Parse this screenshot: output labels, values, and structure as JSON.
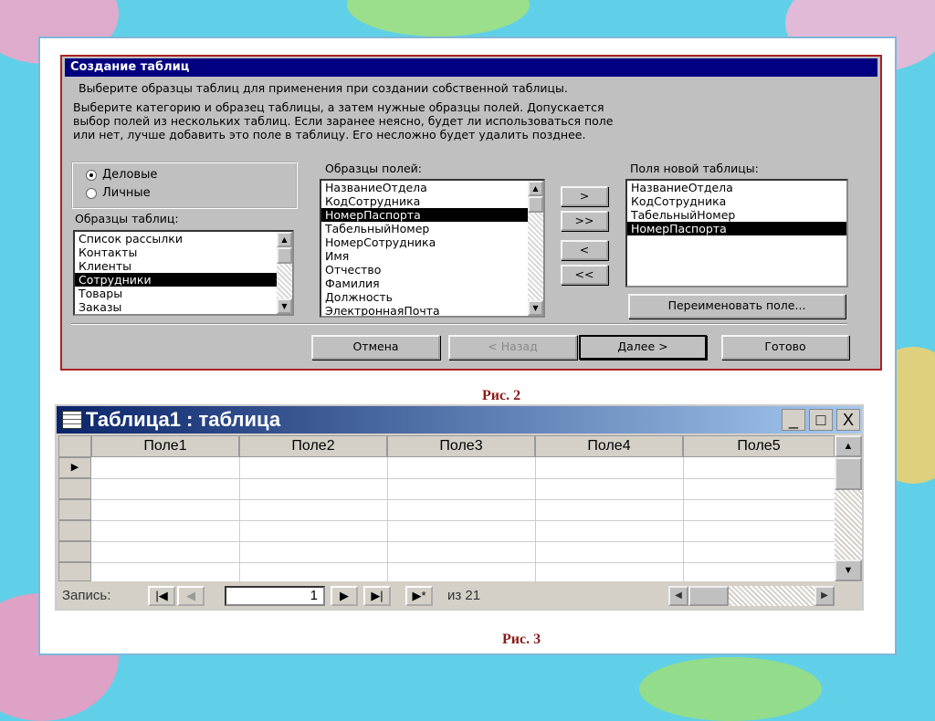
{
  "dialog": {
    "title": "Создание таблиц",
    "subtitle": "Выберите образцы таблиц для применения при создании собственной таблицы.",
    "description": [
      "Выберите категорию и образец таблицы, а затем нужные образцы полей. Допускается",
      "выбор полей из нескольких таблиц. Если заранее неясно, будет ли использоваться поле",
      "или нет, лучше добавить это поле в таблицу. Его несложно будет удалить позднее."
    ],
    "radio_business": "Деловые",
    "radio_personal": "Личные",
    "sample_tables_label": "Образцы таблиц:",
    "sample_tables": [
      "Список рассылки",
      "Контакты",
      "Клиенты",
      "Сотрудники",
      "Товары",
      "Заказы"
    ],
    "sample_fields_label": "Образцы полей:",
    "sample_fields": [
      "НазваниеОтдела",
      "КодСотрудника",
      "НомерПаспорта",
      "ТабельныйНомер",
      "НомерСотрудника",
      "Имя",
      "Отчество",
      "Фамилия",
      "Должность",
      "ЭлектроннаяПочта"
    ],
    "new_fields_label": "Поля новой таблицы:",
    "new_fields": [
      "НазваниеОтдела",
      "КодСотрудника",
      "ТабельныйНомер",
      "НомерПаспорта"
    ],
    "add_one": ">",
    "add_all": ">>",
    "remove_one": "<",
    "remove_all": "<<",
    "rename": "Переименовать поле...",
    "cancel": "Отмена",
    "back": "< Назад",
    "next": "Далее >",
    "finish": "Готово"
  },
  "caption2": "Рис. 2",
  "table": {
    "title": "Таблица1 : таблица",
    "minimize": "_",
    "maximize": "□",
    "close": "X",
    "columns": [
      "Поле1",
      "Поле2",
      "Поле3",
      "Поле4",
      "Поле5"
    ],
    "current_row_marker": "▶",
    "record_label": "Запись:",
    "record_value": "1",
    "record_total": "из 21",
    "first": "|◀",
    "prev": "◀",
    "next": "▶",
    "last": "▶|",
    "new": "▶*"
  },
  "caption3": "Рис. 3"
}
